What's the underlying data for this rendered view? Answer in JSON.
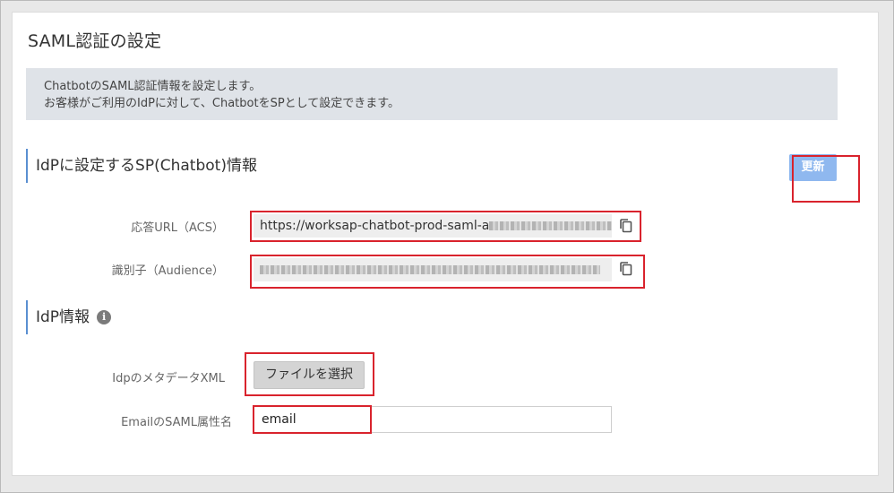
{
  "page": {
    "title": "SAML認証の設定"
  },
  "banner": {
    "line1": "ChatbotのSAML認証情報を設定します。",
    "line2": "お客様がご利用のIdPに対して、ChatbotをSPとして設定できます。"
  },
  "sp_section": {
    "heading": "IdPに設定するSP(Chatbot)情報",
    "update_label": "更新",
    "acs_label": "応答URL（ACS）",
    "acs_value": "https://worksap-chatbot-prod-saml-a",
    "audience_label": "識別子（Audience）",
    "copy_icon": "copy-icon"
  },
  "idp_section": {
    "heading": "IdP情報",
    "info_icon_glyph": "i",
    "metadata_label": "IdpのメタデータXML",
    "file_button_label": "ファイルを選択",
    "email_attr_label": "EmailのSAML属性名",
    "email_attr_value": "email"
  },
  "colors": {
    "accent": "#5a8fd1",
    "update_button": "#8fb8ef",
    "highlight": "#d9232d",
    "banner_bg": "#dfe3e8"
  }
}
